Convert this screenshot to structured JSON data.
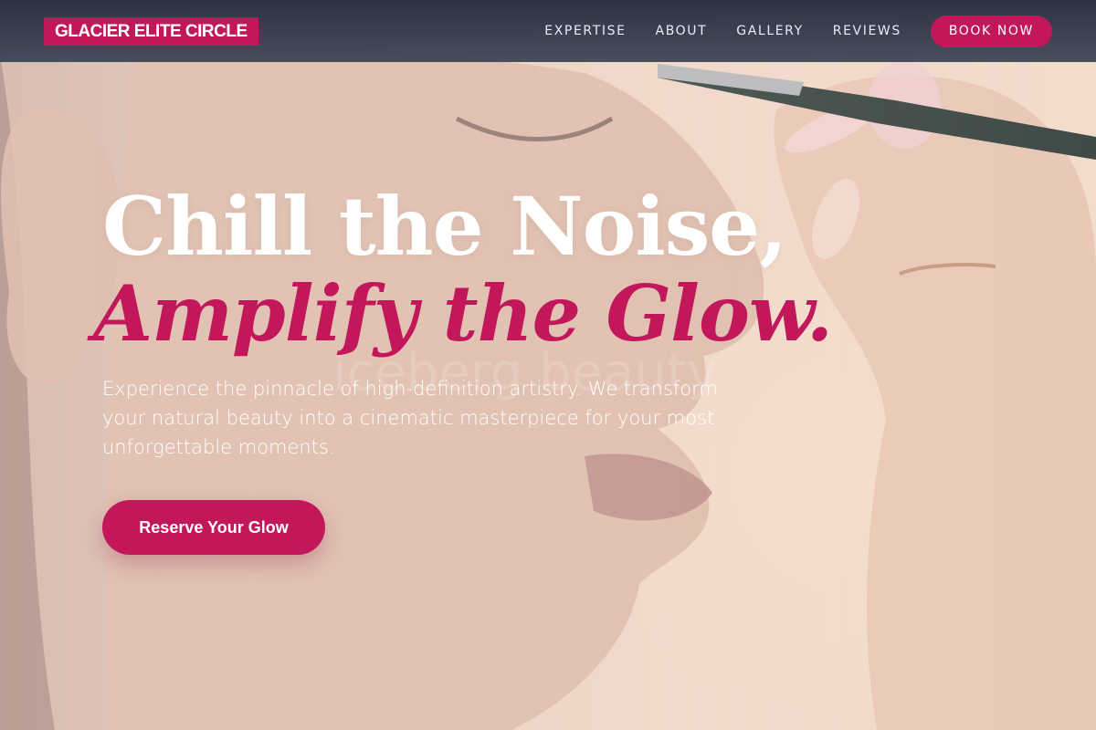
{
  "header": {
    "brand": "GLACIER ELITE CIRCLE",
    "nav": [
      "EXPERTISE",
      "ABOUT",
      "GALLERY",
      "REVIEWS"
    ],
    "cta": "BOOK NOW"
  },
  "hero": {
    "headline_line_1": "Chill the Noise,",
    "headline_line_2": "Amplify the Glow.",
    "lead": "Experience the pinnacle of high-definition artistry. We transform your natural beauty into a cinematic masterpiece for your most unforgettable moments.",
    "cta": "Reserve Your Glow",
    "watermark": "iceberg beauty"
  },
  "colors": {
    "accent": "#c2185b",
    "header_bg": "#2a3142",
    "text_light": "#ffffff"
  },
  "icons": [
    "makeup-brush-photo"
  ]
}
